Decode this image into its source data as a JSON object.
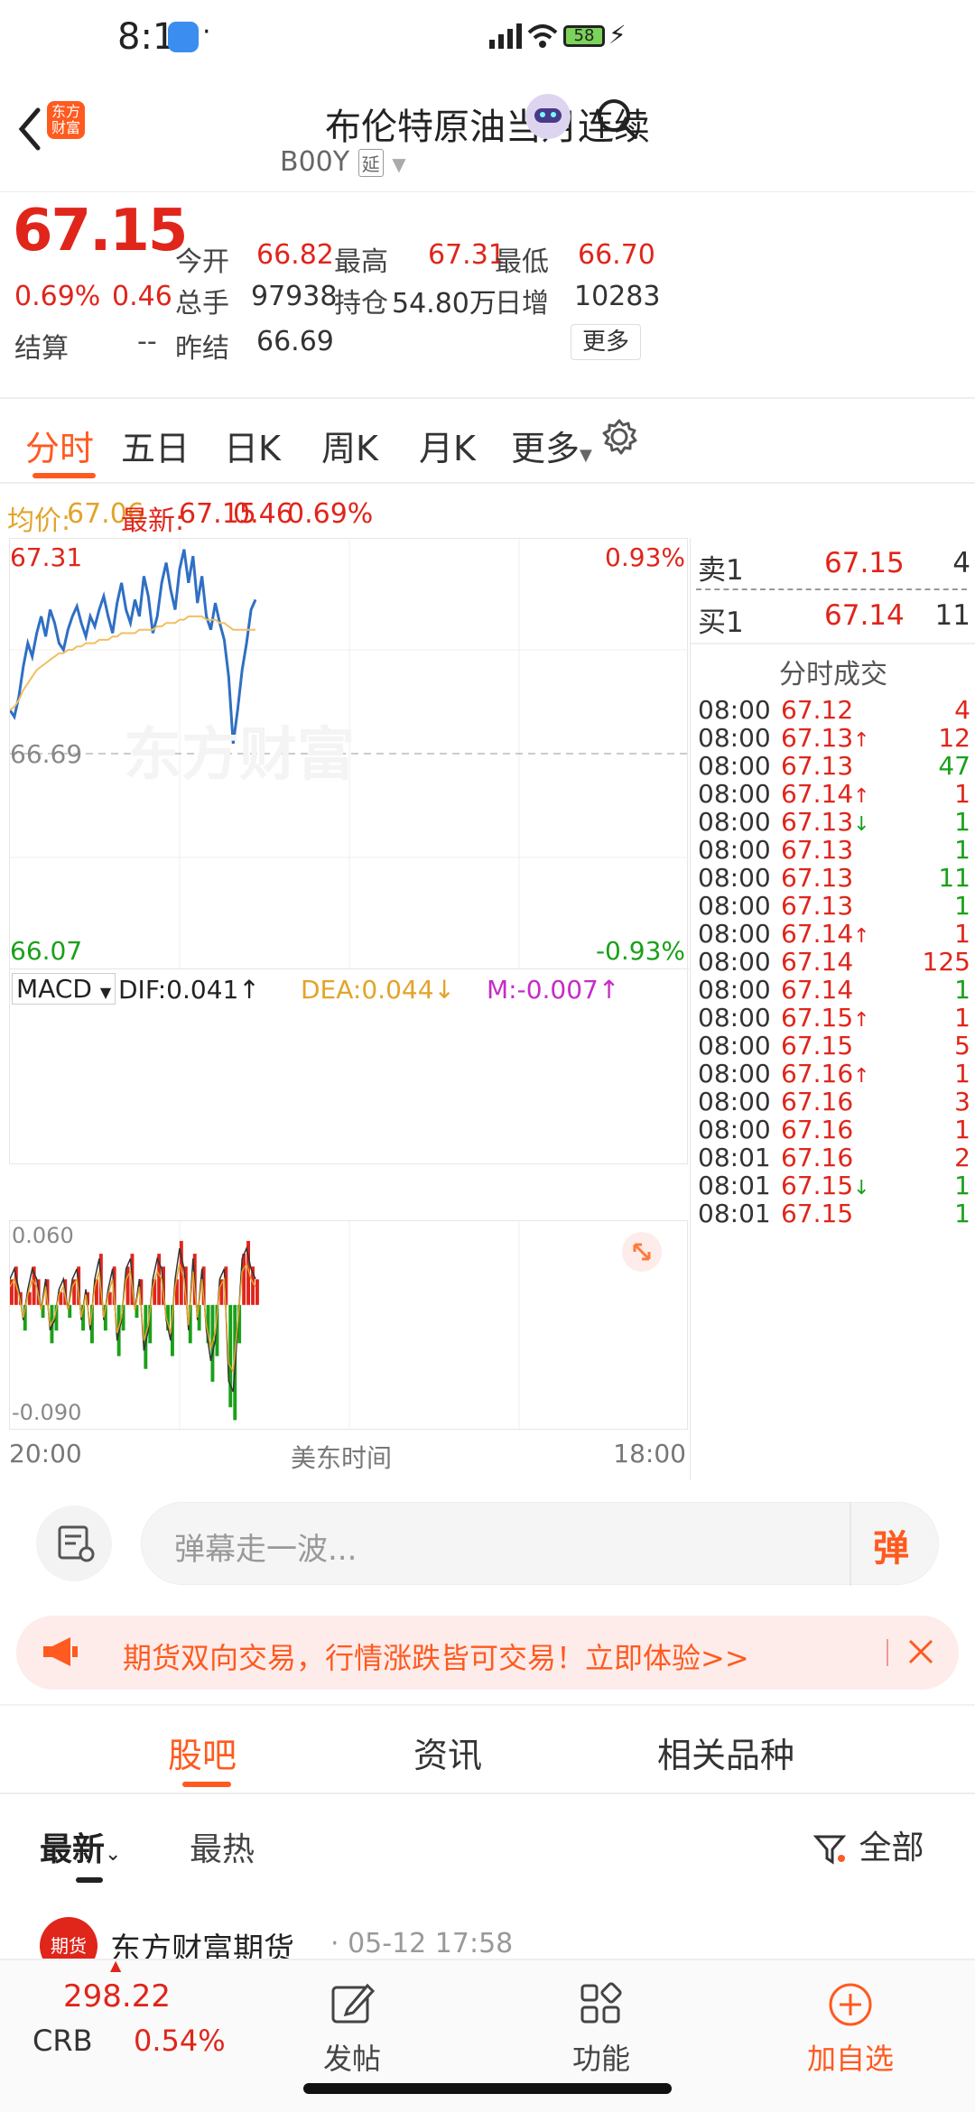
{
  "status_bar": {
    "time": "8:11",
    "battery": "58"
  },
  "header": {
    "title": "布伦特原油当月连续",
    "code": "B00Y",
    "delay_badge": "延",
    "logo_line1": "东方",
    "logo_line2": "财富"
  },
  "quote": {
    "price": "67.15",
    "change_pct": "0.69%",
    "change": "0.46",
    "settle_label": "结算",
    "settle_value": "--",
    "fields": [
      {
        "label": "今开",
        "value": "66.82"
      },
      {
        "label": "最高",
        "value": "67.31"
      },
      {
        "label": "最低",
        "value": "66.70"
      },
      {
        "label": "总手",
        "value": "97938"
      },
      {
        "label": "持仓",
        "value": "54.80万"
      },
      {
        "label": "日增",
        "value": "10283"
      },
      {
        "label": "昨结",
        "value": "66.69"
      }
    ],
    "more_button": "更多"
  },
  "tabs": [
    "分时",
    "五日",
    "日K",
    "周K",
    "月K",
    "更多"
  ],
  "chart_info": {
    "avg_label": "均价:",
    "avg_value": "67.06",
    "latest_label": "最新:",
    "latest_value": "67.15",
    "change": "0.46",
    "pct": "0.69%"
  },
  "chart_labels": {
    "y_max": "67.31",
    "y_max_pct": "0.93%",
    "y_mid": "66.69",
    "y_min": "66.07",
    "y_min_pct": "-0.93%",
    "watermark": "东方财富",
    "x_start": "20:00",
    "x_mid": "美东时间",
    "x_end": "18:00"
  },
  "macd": {
    "label": "MACD",
    "dif": "DIF:0.041",
    "dea": "DEA:0.044",
    "m": "M:-0.007",
    "top": "0.060",
    "bottom": "-0.090"
  },
  "order_book": {
    "sell_label": "卖1",
    "sell_price": "67.15",
    "sell_vol": "4",
    "buy_label": "买1",
    "buy_price": "67.14",
    "buy_vol": "11",
    "trades_title": "分时成交"
  },
  "trades": [
    {
      "time": "08:00",
      "price": "67.12",
      "arrow": "",
      "vol": "4",
      "vcolor": "red"
    },
    {
      "time": "08:00",
      "price": "67.13",
      "arrow": "↑",
      "vol": "12",
      "vcolor": "red"
    },
    {
      "time": "08:00",
      "price": "67.13",
      "arrow": "",
      "vol": "47",
      "vcolor": "green"
    },
    {
      "time": "08:00",
      "price": "67.14",
      "arrow": "↑",
      "vol": "1",
      "vcolor": "red"
    },
    {
      "time": "08:00",
      "price": "67.13",
      "arrow": "↓",
      "vol": "1",
      "vcolor": "green"
    },
    {
      "time": "08:00",
      "price": "67.13",
      "arrow": "",
      "vol": "1",
      "vcolor": "green"
    },
    {
      "time": "08:00",
      "price": "67.13",
      "arrow": "",
      "vol": "11",
      "vcolor": "green"
    },
    {
      "time": "08:00",
      "price": "67.13",
      "arrow": "",
      "vol": "1",
      "vcolor": "green"
    },
    {
      "time": "08:00",
      "price": "67.14",
      "arrow": "↑",
      "vol": "1",
      "vcolor": "red"
    },
    {
      "time": "08:00",
      "price": "67.14",
      "arrow": "",
      "vol": "125",
      "vcolor": "red"
    },
    {
      "time": "08:00",
      "price": "67.14",
      "arrow": "",
      "vol": "1",
      "vcolor": "green"
    },
    {
      "time": "08:00",
      "price": "67.15",
      "arrow": "↑",
      "vol": "1",
      "vcolor": "red"
    },
    {
      "time": "08:00",
      "price": "67.15",
      "arrow": "",
      "vol": "5",
      "vcolor": "red"
    },
    {
      "time": "08:00",
      "price": "67.16",
      "arrow": "↑",
      "vol": "1",
      "vcolor": "red"
    },
    {
      "time": "08:00",
      "price": "67.16",
      "arrow": "",
      "vol": "3",
      "vcolor": "red"
    },
    {
      "time": "08:00",
      "price": "67.16",
      "arrow": "",
      "vol": "1",
      "vcolor": "red"
    },
    {
      "time": "08:01",
      "price": "67.16",
      "arrow": "",
      "vol": "2",
      "vcolor": "red"
    },
    {
      "time": "08:01",
      "price": "67.15",
      "arrow": "↓",
      "vol": "1",
      "vcolor": "green"
    },
    {
      "time": "08:01",
      "price": "67.15",
      "arrow": "",
      "vol": "1",
      "vcolor": "green"
    }
  ],
  "danmu": {
    "placeholder": "弹幕走一波...",
    "button": "弹"
  },
  "promo": {
    "text": "期货双向交易，行情涨跌皆可交易！立即体验>>"
  },
  "subtabs": [
    "股吧",
    "资讯",
    "相关品种"
  ],
  "filter": {
    "latest": "最新",
    "hot": "最热",
    "all": "全部"
  },
  "post": {
    "author": "东方财富期货",
    "time": "· 05-12 17:58",
    "avatar_text": "期货"
  },
  "bottom_nav": {
    "index_value": "298.22",
    "index_name": "CRB",
    "index_pct": "0.54%",
    "post": "发帖",
    "features": "功能",
    "add_watch": "加自选"
  },
  "colors": {
    "up": "#e0251b",
    "down": "#1aa01a",
    "accent": "#ff5a1f",
    "price_line": "#2f6fc4",
    "avg_line": "#f0c060"
  },
  "chart_data": {
    "type": "line",
    "ylim": [
      66.07,
      67.31
    ],
    "prev_settle": 66.69,
    "series": [
      {
        "values": [
          66.82,
          66.8,
          66.86,
          66.95,
          67.02,
          66.98,
          67.05,
          67.1,
          67.04,
          67.12,
          67.08,
          67.02,
          67.0,
          67.06,
          67.1,
          67.13,
          67.08,
          67.04,
          67.1,
          67.07,
          67.12,
          67.16,
          67.1,
          67.05,
          67.14,
          67.2,
          67.12,
          67.08,
          67.15,
          67.1,
          67.22,
          67.16,
          67.05,
          67.1,
          67.2,
          67.26,
          67.18,
          67.12,
          67.24,
          67.3,
          67.2,
          67.28,
          67.14,
          67.22,
          67.1,
          67.06,
          67.14,
          67.08,
          67.03,
          66.92,
          66.72,
          66.82,
          66.94,
          67.02,
          67.12,
          67.15
        ]
      },
      {
        "values": [
          66.82,
          66.83,
          66.85,
          66.88,
          66.9,
          66.92,
          66.94,
          66.95,
          66.96,
          66.97,
          66.98,
          66.99,
          66.99,
          67.0,
          67.0,
          67.01,
          67.01,
          67.02,
          67.02,
          67.02,
          67.03,
          67.03,
          67.03,
          67.04,
          67.04,
          67.05,
          67.05,
          67.05,
          67.05,
          67.06,
          67.06,
          67.06,
          67.06,
          67.07,
          67.07,
          67.08,
          67.08,
          67.08,
          67.09,
          67.09,
          67.1,
          67.1,
          67.1,
          67.1,
          67.09,
          67.09,
          67.09,
          67.08,
          67.08,
          67.07,
          67.06,
          67.06,
          67.06,
          67.06,
          67.06,
          67.06
        ]
      }
    ],
    "macd_hist": [
      0.02,
      0.03,
      0.01,
      -0.02,
      0.01,
      0.03,
      0.02,
      -0.01,
      0.02,
      -0.03,
      -0.02,
      0.01,
      0.02,
      -0.01,
      0.02,
      0.03,
      -0.02,
      0.01,
      -0.03,
      0.02,
      0.04,
      -0.02,
      0.01,
      0.03,
      -0.04,
      -0.02,
      0.03,
      0.04,
      -0.01,
      0.02,
      -0.05,
      -0.03,
      0.02,
      0.04,
      0.03,
      -0.02,
      -0.04,
      0.02,
      0.05,
      0.03,
      -0.03,
      0.04,
      -0.02,
      0.03,
      -0.03,
      -0.06,
      -0.04,
      0.02,
      0.03,
      -0.08,
      -0.09,
      -0.03,
      0.04,
      0.05,
      0.03,
      0.02
    ]
  }
}
